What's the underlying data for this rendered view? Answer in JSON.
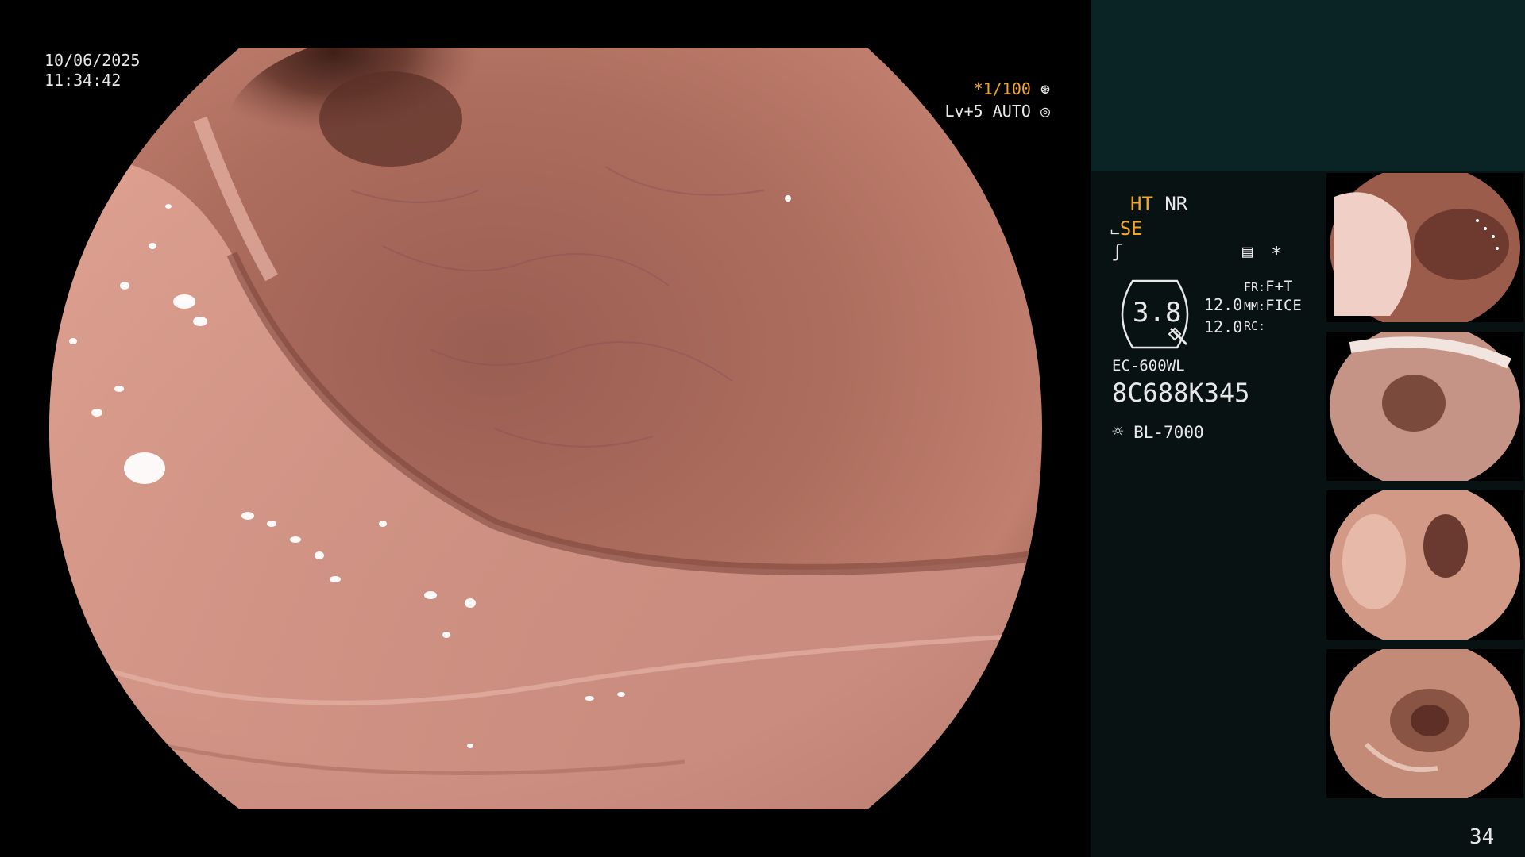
{
  "overlay": {
    "date": "10/06/2025",
    "time": "11:34:42",
    "shutter": "*1/100",
    "iris": "Lv+5 AUTO"
  },
  "settings": {
    "ht": "HT",
    "nr": "NR",
    "se": "SE",
    "zoom_value": "3.8",
    "enh_1": "12.0",
    "enh_2": "12.0",
    "fr_label": "FR:",
    "fr_value": "F+T",
    "mm_label": "MM:",
    "mm_value": "FICE",
    "rc_label": "RC:",
    "scope_model": "EC-600WL",
    "scope_serial": "8C688K345",
    "light_source": "BL-7000",
    "asterisk": "*"
  },
  "frame_counter": "34",
  "colors": {
    "accent": "#f5a623",
    "panel_bg": "#081213",
    "panel_header": "#0a2426",
    "tissue": "#b77666"
  }
}
